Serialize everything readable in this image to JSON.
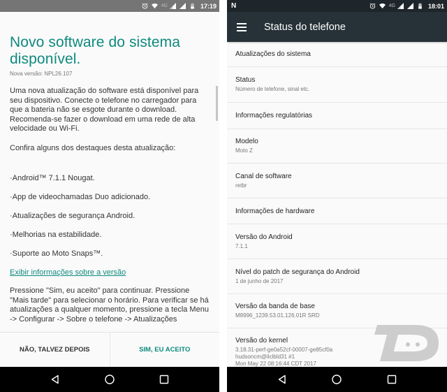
{
  "left_screen": {
    "status_bar": {
      "icons": [
        "alarm-icon",
        "wifi-icon",
        "4g-icon",
        "signal-icon",
        "signal-icon",
        "battery-icon"
      ],
      "network_label": "4G",
      "time": "17:19"
    },
    "dialog": {
      "title": "Novo software do sistema disponível.",
      "version": "Nova versão: NPL26.107",
      "intro": "Uma nova atualização do software está disponível para seu dispositivo. Conecte o telefone no carregador para que a bateria não se esgote durante o download. Recomenda-se fazer o download em uma rede de alta velocidade ou Wi-Fi.",
      "highlights_heading": "Confira alguns dos destaques desta atualização:",
      "highlights": [
        "·Android™ 7.1.1 Nougat.",
        "·App de videochamadas Duo adicionado.",
        "·Atualizações de segurança Android.",
        "·Melhorias na estabilidade.",
        "·Suporte ao Moto Snaps™."
      ],
      "link": "Exibir informações sobre a versão",
      "instructions": "Pressione \"Sim, eu aceito\" para continuar. Pressione \"Mais tarde\" para selecionar o horário. Para verificar se há atualizações a qualquer momento, pressione a tecla Menu -> Configurar -> Sobre o telefone -> Atualizações",
      "negative_button": "NÃO, TALVEZ DEPOIS",
      "positive_button": "SIM, EU ACEITO"
    },
    "nav_bar": {
      "back": "back-icon",
      "home": "home-icon",
      "recents": "recents-icon"
    }
  },
  "right_screen": {
    "status_bar": {
      "notification_icon": "N",
      "network_label": "4G",
      "time": "18:01"
    },
    "app_bar": {
      "title": "Status do telefone"
    },
    "items": [
      {
        "title": "Atualizações do sistema",
        "subtitle": ""
      },
      {
        "title": "Status",
        "subtitle": "Número de telefone, sinal etc."
      },
      {
        "title": "Informações regulatórias",
        "subtitle": ""
      },
      {
        "title": "Modelo",
        "subtitle": "Moto Z"
      },
      {
        "title": "Canal de software",
        "subtitle": "retbr"
      },
      {
        "title": "Informações de hardware",
        "subtitle": ""
      },
      {
        "title": "Versão do Android",
        "subtitle": "7.1.1"
      },
      {
        "title": "Nível do patch de segurança do Android",
        "subtitle": "1 de junho de 2017"
      },
      {
        "title": "Versão da banda de base",
        "subtitle": "M8996_1239.53.01.126.01R SRD"
      },
      {
        "title": "Versão do kernel",
        "subtitle": "3.18.31-perf-ge0a52cf-00007-ge85cf0a\nhudsoncm@ilclbld31 #1\nMon May 22 08:16:44 CDT 2017"
      }
    ]
  },
  "colors": {
    "accent": "#0e8a7e",
    "app_bar": "#263238",
    "status_bar_left": "#757575",
    "status_bar_right": "#1e262b"
  }
}
